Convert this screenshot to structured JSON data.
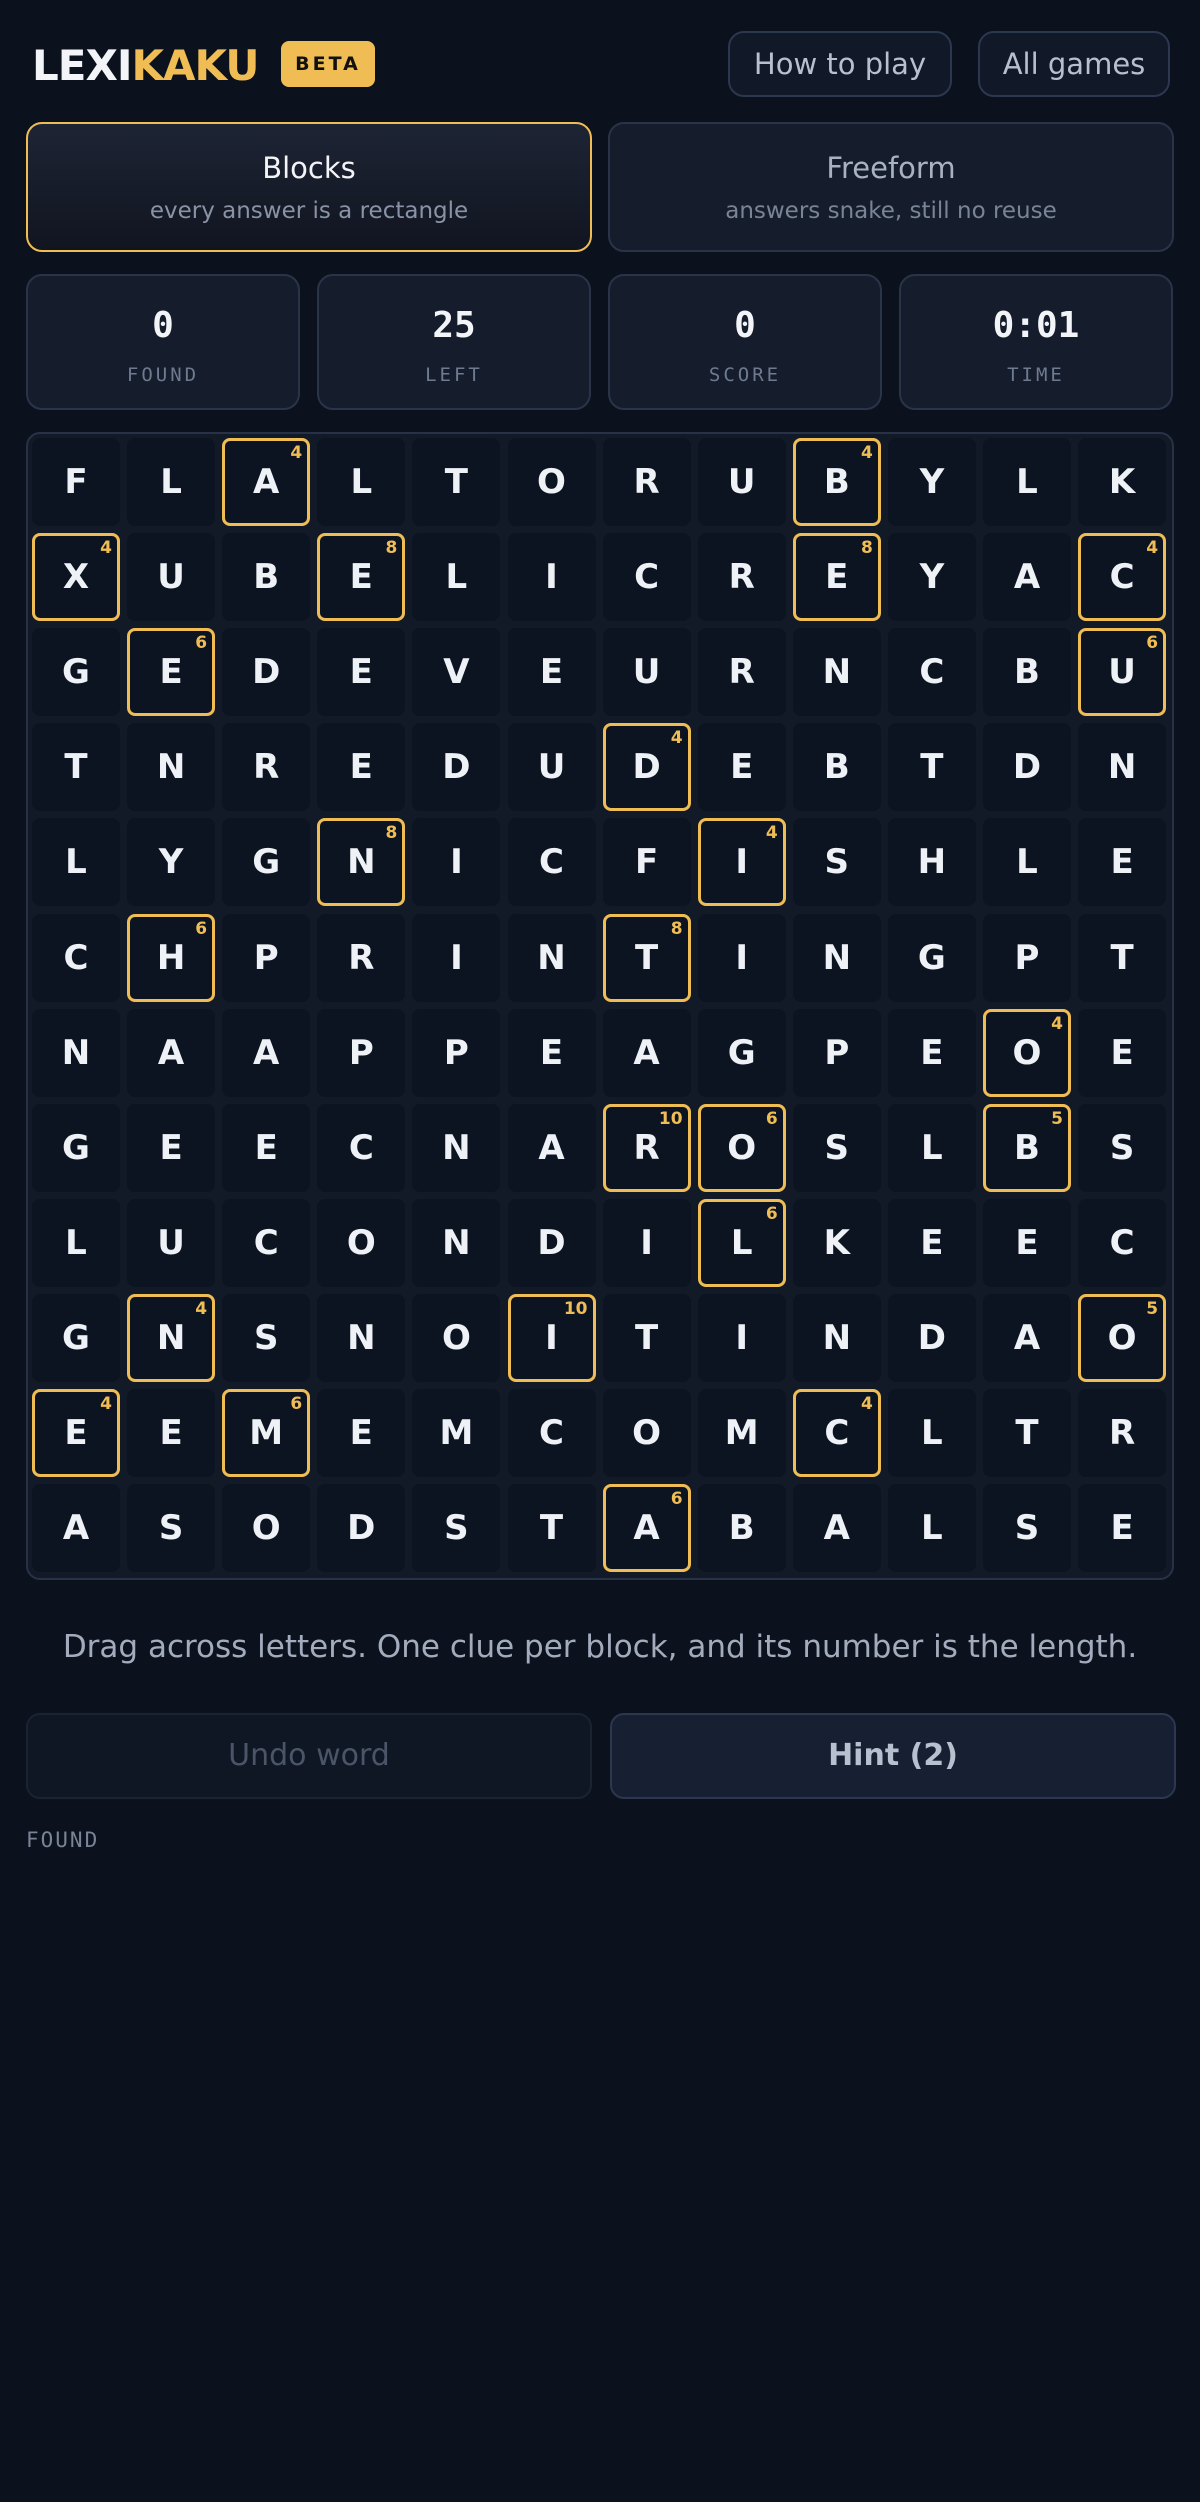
{
  "header": {
    "logo_part1": "LEXI",
    "logo_part2": "KAKU",
    "badge": "BETA",
    "how_to_play": "How to play",
    "all_games": "All games"
  },
  "modes": [
    {
      "title": "Blocks",
      "subtitle": "every answer is a rectangle",
      "selected": true
    },
    {
      "title": "Freeform",
      "subtitle": "answers snake, still no reuse",
      "selected": false
    }
  ],
  "stats": [
    {
      "value": "0",
      "label": "FOUND"
    },
    {
      "value": "25",
      "label": "LEFT"
    },
    {
      "value": "0",
      "label": "SCORE"
    },
    {
      "value": "0:01",
      "label": "TIME"
    }
  ],
  "grid": {
    "rows": [
      "FLALTORUBYLK",
      "XUBELICREYAC",
      "GEDEVEURNCBU",
      "TNREDUDEBTDN",
      "LYGNICFISHLE",
      "CHPRINTINGPT",
      "NAAPPEAGPEOE",
      "GEECNAROSLBS",
      "LUCONDILKEEC",
      "GNSNOITINDAO",
      "EEMEMCOMCLTR",
      "ASODSTABALSE"
    ],
    "clues": [
      {
        "row": 0,
        "col": 2,
        "length": "4"
      },
      {
        "row": 0,
        "col": 8,
        "length": "4"
      },
      {
        "row": 1,
        "col": 0,
        "length": "4"
      },
      {
        "row": 1,
        "col": 3,
        "length": "8"
      },
      {
        "row": 1,
        "col": 8,
        "length": "8"
      },
      {
        "row": 1,
        "col": 11,
        "length": "4"
      },
      {
        "row": 2,
        "col": 1,
        "length": "6"
      },
      {
        "row": 2,
        "col": 11,
        "length": "6"
      },
      {
        "row": 3,
        "col": 6,
        "length": "4"
      },
      {
        "row": 4,
        "col": 3,
        "length": "8"
      },
      {
        "row": 4,
        "col": 7,
        "length": "4"
      },
      {
        "row": 5,
        "col": 1,
        "length": "6"
      },
      {
        "row": 5,
        "col": 6,
        "length": "8"
      },
      {
        "row": 6,
        "col": 10,
        "length": "4"
      },
      {
        "row": 7,
        "col": 6,
        "length": "10"
      },
      {
        "row": 7,
        "col": 7,
        "length": "6"
      },
      {
        "row": 7,
        "col": 10,
        "length": "5"
      },
      {
        "row": 8,
        "col": 7,
        "length": "6"
      },
      {
        "row": 9,
        "col": 1,
        "length": "4"
      },
      {
        "row": 9,
        "col": 5,
        "length": "10"
      },
      {
        "row": 9,
        "col": 11,
        "length": "5"
      },
      {
        "row": 10,
        "col": 0,
        "length": "4"
      },
      {
        "row": 10,
        "col": 2,
        "length": "6"
      },
      {
        "row": 10,
        "col": 8,
        "length": "4"
      },
      {
        "row": 11,
        "col": 6,
        "length": "6"
      }
    ]
  },
  "instructions": "Drag across letters. One clue per block, and its number is the length.",
  "actions": {
    "undo": "Undo word",
    "hint": "Hint (2)"
  },
  "found_section": {
    "title": "FOUND"
  },
  "colors": {
    "accent": "#f0bd55",
    "background": "#0b111d"
  }
}
